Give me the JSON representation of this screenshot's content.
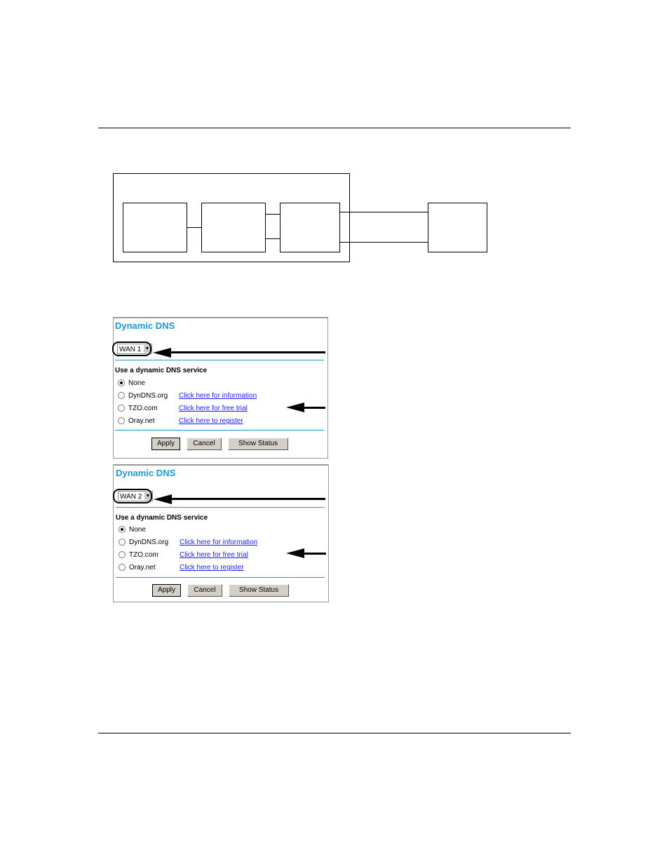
{
  "panels": [
    {
      "title": "Dynamic DNS",
      "wan": "WAN 1",
      "service_label": "Use a dynamic DNS service",
      "options": [
        {
          "label": "None",
          "selected": true
        },
        {
          "label": "DynDNS.org",
          "link": "Click here for information"
        },
        {
          "label": "TZO.com",
          "link": "Click here for free trial"
        },
        {
          "label": "Oray.net",
          "link": "Click here to register"
        }
      ],
      "buttons": {
        "apply": "Apply",
        "cancel": "Cancel",
        "status": "Show Status"
      }
    },
    {
      "title": "Dynamic DNS",
      "wan": "WAN 2",
      "service_label": "Use a dynamic DNS service",
      "options": [
        {
          "label": "None",
          "selected": true
        },
        {
          "label": "DynDNS.org",
          "link": "Click here for information"
        },
        {
          "label": "TZO.com",
          "link": "Click here for free trial"
        },
        {
          "label": "Oray.net",
          "link": "Click here to register"
        }
      ],
      "buttons": {
        "apply": "Apply",
        "cancel": "Cancel",
        "status": "Show Status"
      }
    }
  ],
  "colors": {
    "accent": "#1a9ad6",
    "link": "#1a1aff"
  }
}
